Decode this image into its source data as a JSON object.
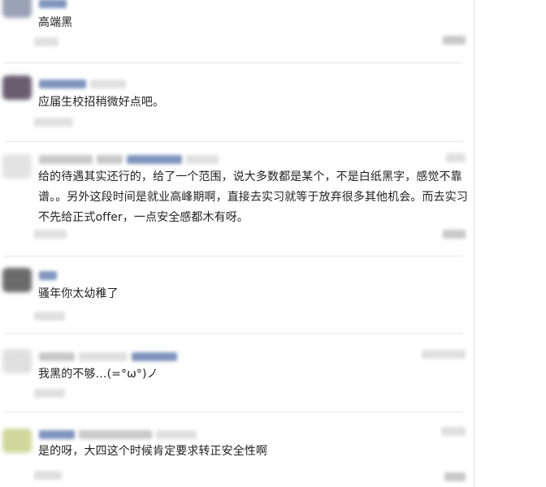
{
  "comments": [
    {
      "text": "高端黑"
    },
    {
      "text": "应届生校招稍微好点吧。"
    },
    {
      "text": "给的待遇其实还行的，给了一个范围，说大多数都是某个，不是白纸黑字，感觉不靠谱。。另外这段时间是就业高峰期啊，直接去实习就等于放弃很多其他机会。而去实习不先给正式offer，一点安全感都木有呀。"
    },
    {
      "text": "骚年你太幼稚了"
    },
    {
      "text": "我黑的不够…(=°ω°)ノ"
    },
    {
      "text": "是的呀，大四这个时候肯定要求转正安全性啊"
    }
  ],
  "colors": {
    "text": "#222222",
    "username_blur": "#7f95bd",
    "meta_blur": "#c9c9c9",
    "divider": "#e6e6e6"
  },
  "icons": [
    "avatar"
  ]
}
